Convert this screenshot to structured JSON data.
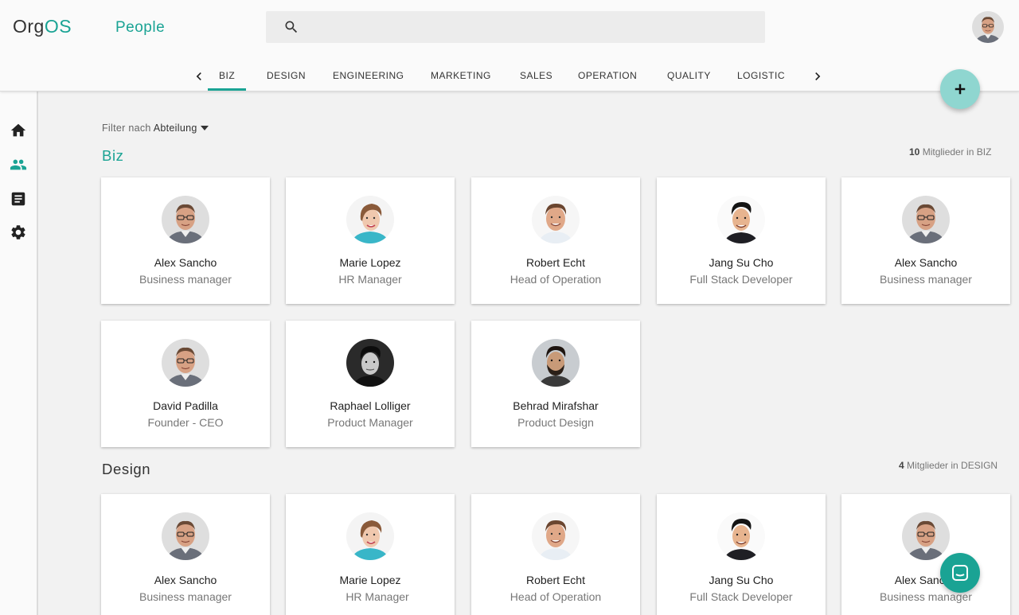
{
  "app": {
    "logo_prefix": "Org",
    "logo_suffix": "OS",
    "section": "People"
  },
  "search": {
    "placeholder": ""
  },
  "tabs": [
    "BIZ",
    "DESIGN",
    "ENGINEERING",
    "MARKETING",
    "SALES",
    "OPERATION",
    "QUALITY",
    "LOGISTIC"
  ],
  "filter": {
    "label": "Filter nach",
    "value": "Abteilung"
  },
  "groups": [
    {
      "title": "Biz",
      "count": "10",
      "count_text": "Mitglieder in BIZ",
      "members": [
        {
          "name": "Alex Sancho",
          "role": "Business manager"
        },
        {
          "name": "Marie Lopez",
          "role": "HR Manager"
        },
        {
          "name": "Robert Echt",
          "role": "Head of Operation"
        },
        {
          "name": "Jang Su Cho",
          "role": "Full Stack Developer"
        },
        {
          "name": "Alex Sancho",
          "role": "Business manager"
        },
        {
          "name": "David Padilla",
          "role": "Founder - CEO"
        },
        {
          "name": "Raphael Lolliger",
          "role": "Product Manager"
        },
        {
          "name": "Behrad Mirafshar",
          "role": "Product Design"
        }
      ]
    },
    {
      "title": "Design",
      "count": "4",
      "count_text": "Mitglieder in DESIGN",
      "members": [
        {
          "name": "Alex Sancho",
          "role": "Business manager"
        },
        {
          "name": "Marie Lopez",
          "role": "HR Manager"
        },
        {
          "name": "Robert Echt",
          "role": "Head of Operation"
        },
        {
          "name": "Jang Su Cho",
          "role": "Full Stack Developer"
        },
        {
          "name": "Alex Sancho",
          "role": "Business manager"
        }
      ]
    }
  ],
  "colors": {
    "accent": "#1aa394",
    "fab": "#8fd6d0"
  },
  "icons": [
    "search-icon",
    "home-icon",
    "people-icon",
    "article-icon",
    "settings-icon",
    "add-icon",
    "chat-icon",
    "chevron-left-icon",
    "chevron-right-icon"
  ]
}
